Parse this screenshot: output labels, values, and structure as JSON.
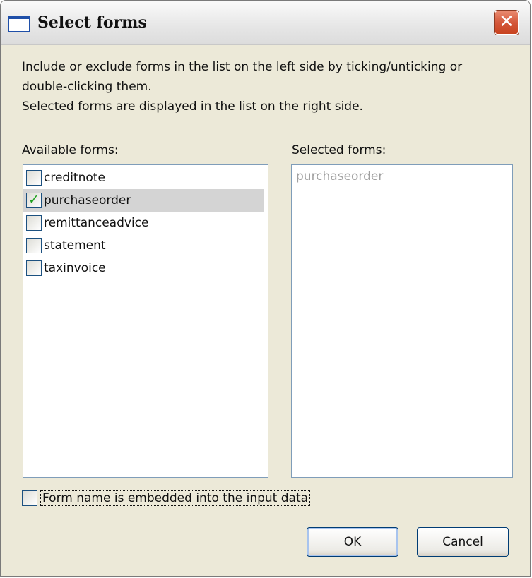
{
  "window": {
    "title": "Select forms",
    "close_glyph": "✕"
  },
  "description": {
    "line1": "Include or exclude forms in the list on the left side by ticking/unticking or",
    "line2": "double-clicking them.",
    "line3": "Selected forms are displayed in the list on the right side."
  },
  "available": {
    "label": "Available forms:",
    "items": [
      {
        "label": "creditnote",
        "checked": false
      },
      {
        "label": "purchaseorder",
        "checked": true
      },
      {
        "label": "remittanceadvice",
        "checked": false
      },
      {
        "label": "statement",
        "checked": false
      },
      {
        "label": "taxinvoice",
        "checked": false
      }
    ]
  },
  "selected": {
    "label": "Selected forms:",
    "items": [
      "purchaseorder"
    ]
  },
  "embed_option": {
    "label": "Form name is embedded into the input data",
    "checked": false
  },
  "buttons": {
    "ok_label": "OK",
    "cancel_label": "Cancel"
  },
  "colors": {
    "check_mark": "#21a121",
    "close_button": "#d4573a",
    "selection_highlight": "#d4d4d4"
  }
}
